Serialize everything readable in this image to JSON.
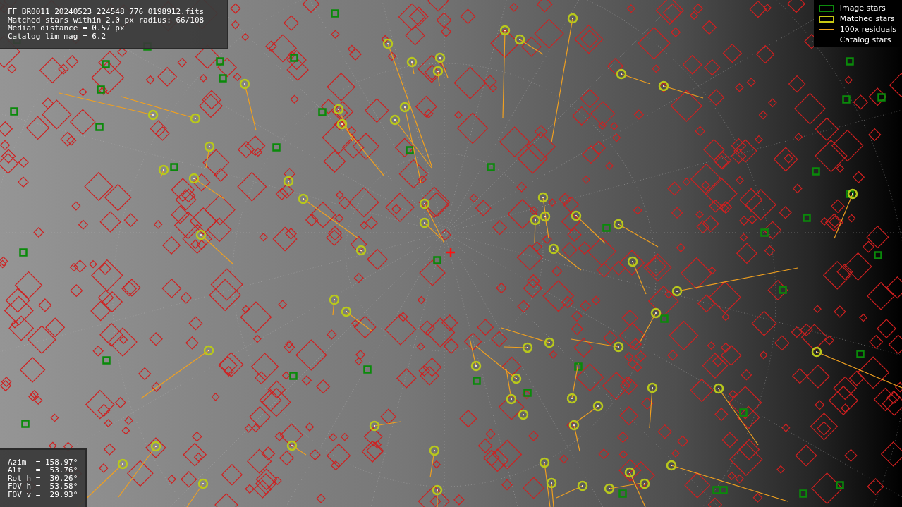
{
  "info_panel": {
    "lines": [
      "FF_BR0011_20240523_224548_776_0198912.fits",
      "Matched stars within 2.0 px radius: 66/108",
      "Median distance = 0.57 px",
      "Catalog lim mag = 6.2"
    ]
  },
  "legend": {
    "items": [
      {
        "kind": "image",
        "label": "Image stars"
      },
      {
        "kind": "matched",
        "label": "Matched stars"
      },
      {
        "kind": "residual",
        "label": "100x residuals"
      },
      {
        "kind": "catalog",
        "label": "Catalog stars"
      }
    ]
  },
  "pointing_panel": {
    "lines": [
      "Azim  = 158.97°",
      "Alt   =  53.76°",
      "Rot h =  30.26°",
      "FOV h =  53.58°",
      "FOV v =  29.93°"
    ]
  }
}
